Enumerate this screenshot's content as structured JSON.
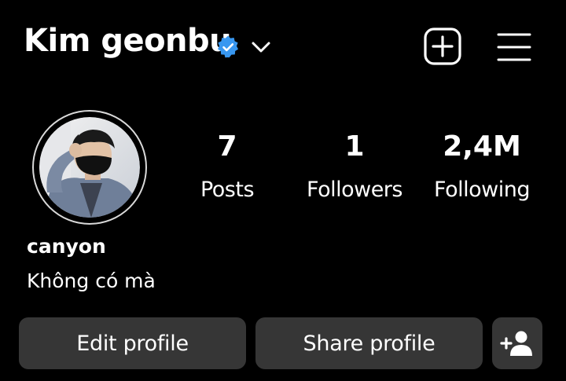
{
  "header": {
    "username": "Kim geonbu",
    "verified_icon": "verified-badge-icon",
    "dropdown_icon": "chevron-down-icon",
    "create_icon": "add-square-icon",
    "menu_icon": "hamburger-menu-icon"
  },
  "profile": {
    "avatar_icon": "profile-photo",
    "display_name": "canyon",
    "bio": "Không có mà"
  },
  "stats": {
    "posts": {
      "value": "7",
      "label": "Posts"
    },
    "followers": {
      "value": "1",
      "label": "Followers"
    },
    "following": {
      "value": "2,4M",
      "label": "Following"
    }
  },
  "actions": {
    "edit_label": "Edit profile",
    "share_label": "Share profile",
    "discover_icon": "add-person-icon"
  },
  "colors": {
    "background": "#000000",
    "text": "#ffffff",
    "button_bg": "#363636",
    "verified_blue": "#3897f0"
  }
}
